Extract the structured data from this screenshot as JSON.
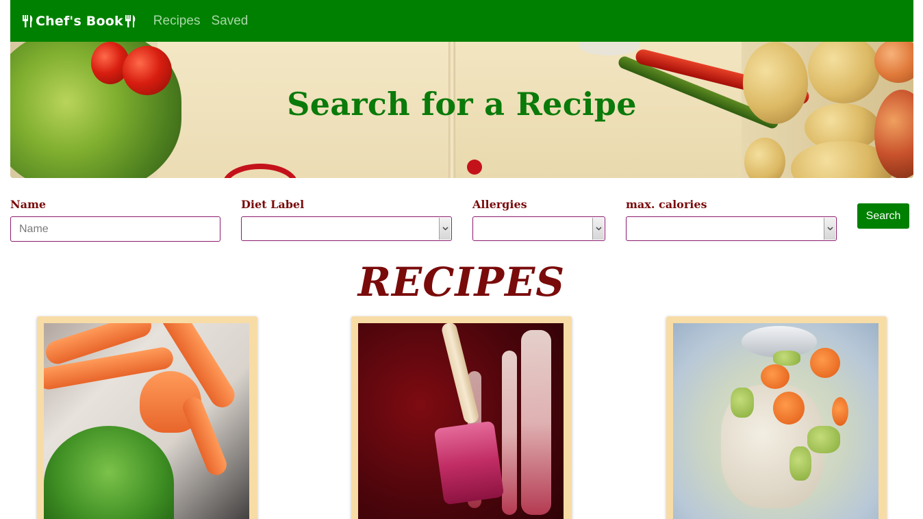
{
  "navbar": {
    "brand": "Chef's Book",
    "links": [
      {
        "label": "Recipes"
      },
      {
        "label": "Saved"
      }
    ]
  },
  "hero": {
    "title": "Search for a Recipe"
  },
  "search_form": {
    "name": {
      "label": "Name",
      "placeholder": "Name",
      "value": ""
    },
    "diet_label": {
      "label": "Diet Label",
      "value": ""
    },
    "allergies": {
      "label": "Allergies",
      "value": ""
    },
    "max_calories": {
      "label": "max. calories",
      "value": ""
    },
    "search_button": "Search"
  },
  "recipes": {
    "heading": "RECIPES",
    "cards": [
      {
        "image": "crab-legs-with-greens"
      },
      {
        "image": "beet-juice-with-spatula"
      },
      {
        "image": "chicken-vegetable-soup"
      }
    ]
  },
  "colors": {
    "nav_green": "#008000",
    "heading_maroon": "#7a0b0b",
    "card_background": "#f8dca6",
    "input_border": "#8b1a6b"
  }
}
